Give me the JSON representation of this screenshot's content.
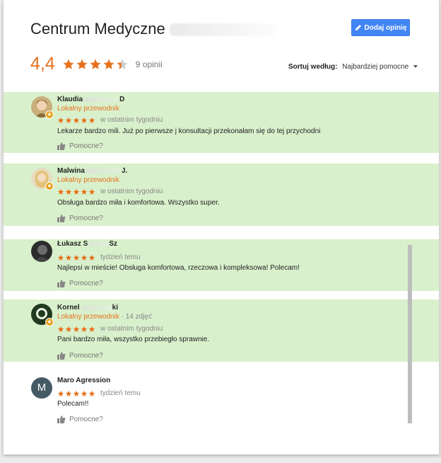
{
  "header": {
    "title": "Centrum Medyczne",
    "add_review_label": "Dodaj opinię",
    "rating": "4,4",
    "rating_value": 4.4,
    "review_count": "9 opinii",
    "sort_label": "Sortuj według:",
    "sort_value": "Najbardziej pomocne"
  },
  "colors": {
    "accent_orange": "#e7711b",
    "highlight_green": "#d9f0cc",
    "button_blue": "#4285f4"
  },
  "reviews": [
    {
      "name": "Klaudia",
      "name_suffix": "D",
      "guide": "Lokalny przewodnik",
      "photos": "",
      "stars": 5,
      "time": "w ostatnim tygodniu",
      "text": "Lekarze bardzo mili. Już po pierwsze j konsultacji przekonałam się do tej przychodni",
      "helpful": "Pomocne?",
      "highlighted": true,
      "avatar_icon": "photo-avatar-icon"
    },
    {
      "name": "Malwina",
      "name_suffix": "J.",
      "guide": "Lokalny przewodnik",
      "photos": "",
      "stars": 5,
      "time": "w ostatnim tygodniu",
      "text": "Obsługa bardzo miła i komfortowa. Wszystko super.",
      "helpful": "Pomocne?",
      "highlighted": true,
      "avatar_icon": "photo-avatar-icon"
    },
    {
      "name": "Łukasz S",
      "name_suffix": "Sz",
      "guide": "",
      "photos": "",
      "stars": 5,
      "time": "tydzień temu",
      "text": "Najlepsi w mieście! Obsługa komfortowa, rzeczowa i kompleksowa! Polecam!",
      "helpful": "Pomocne?",
      "highlighted": true,
      "avatar_icon": "photo-avatar-icon"
    },
    {
      "name": "Kornel",
      "name_suffix": "ki",
      "guide": "Lokalny przewodnik",
      "photos": "· 14 zdjęć",
      "stars": 5,
      "time": "w ostatnim tygodniu",
      "text": "Pani bardzo miła, wszystko przebiegło sprawnie.",
      "helpful": "Pomocne?",
      "highlighted": true,
      "avatar_icon": "photo-avatar-icon"
    },
    {
      "name": "Maro Agression",
      "name_suffix": "",
      "guide": "",
      "photos": "",
      "stars": 5,
      "time": "tydzień temu",
      "text": "Polecam!!",
      "helpful": "Pomocne?",
      "highlighted": false,
      "avatar_letter": "M",
      "avatar_icon": "letter-avatar-icon"
    }
  ]
}
